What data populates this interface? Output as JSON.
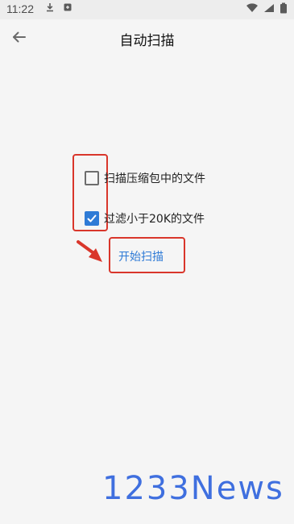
{
  "status_bar": {
    "time": "11:22",
    "left_icons": [
      "download-icon",
      "app-icon"
    ],
    "right_icons": [
      "wifi-icon",
      "signal-icon",
      "battery-icon"
    ]
  },
  "app_bar": {
    "title": "自动扫描",
    "back_icon": "arrow-left-icon"
  },
  "options": [
    {
      "label": "扫描压缩包中的文件",
      "checked": false
    },
    {
      "label": "过滤小于20K的文件",
      "checked": true
    }
  ],
  "start_button": {
    "label": "开始扫描"
  },
  "annotations": {
    "highlight_color": "#d9362b",
    "arrow_color": "#d9362b"
  },
  "watermark": {
    "text": "1233News",
    "color": "#3f6fdf"
  },
  "colors": {
    "accent": "#2f7bd6",
    "background": "#f5f5f5"
  }
}
